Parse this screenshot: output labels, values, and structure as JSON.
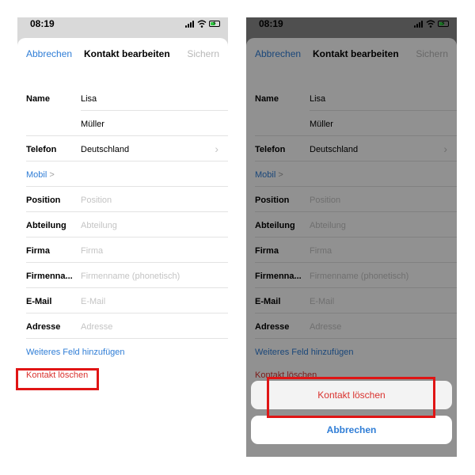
{
  "status": {
    "time": "08:19"
  },
  "nav": {
    "cancel": "Abbrechen",
    "title": "Kontakt bearbeiten",
    "save": "Sichern"
  },
  "form": {
    "name_label": "Name",
    "first_name": "Lisa",
    "last_name": "Müller",
    "phone_label": "Telefon",
    "phone_country": "Deutschland",
    "mobile_label": "Mobil",
    "mobile_chevron": ">",
    "position_label": "Position",
    "position_placeholder": "Position",
    "department_label": "Abteilung",
    "department_placeholder": "Abteilung",
    "company_label": "Firma",
    "company_placeholder": "Firma",
    "company_phonetic_label": "Firmenna...",
    "company_phonetic_placeholder": "Firmenname (phonetisch)",
    "email_label": "E-Mail",
    "email_placeholder": "E-Mail",
    "address_label": "Adresse",
    "address_placeholder": "Adresse",
    "add_field": "Weiteres Feld hinzufügen",
    "delete_contact": "Kontakt löschen"
  },
  "action_sheet": {
    "delete": "Kontakt löschen",
    "cancel": "Abbrechen"
  },
  "colors": {
    "accent": "#2f7dd6",
    "destructive": "#d9322e",
    "highlight": "#e01515"
  }
}
